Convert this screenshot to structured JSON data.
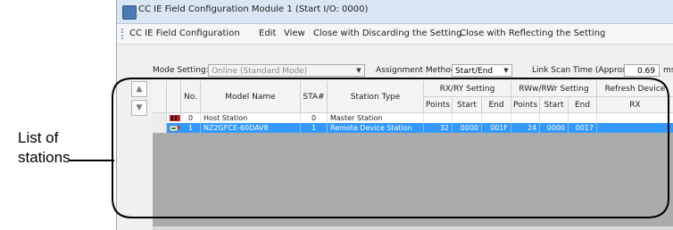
{
  "callout": {
    "label_line1": "List of",
    "label_line2": "stations"
  },
  "window": {
    "title": "CC IE Field Configuration Module 1 (Start I/O: 0000)"
  },
  "menu": {
    "items": [
      "CC IE Field Configuration",
      "Edit",
      "View",
      "Close with Discarding the Setting",
      "Close with Reflecting the Setting"
    ]
  },
  "settings": {
    "mode_label": "Mode Setting:",
    "mode_value": "Online (Standard Mode)",
    "assignment_label": "Assignment Method:",
    "assignment_value": "Start/End",
    "link_scan_label": "Link Scan Time (Approx.):",
    "link_scan_value": "0.69",
    "link_scan_unit": "ms"
  },
  "table": {
    "headers": {
      "no": "No.",
      "model": "Model Name",
      "sta": "STA#",
      "type": "Station Type",
      "rx_group": "RX/RY Setting",
      "rww_group": "RWw/RWr Setting",
      "refresh_group": "Refresh Device",
      "points": "Points",
      "start": "Start",
      "end": "End",
      "rx": "RX"
    },
    "rows": [
      {
        "no": "0",
        "model": "Host Station",
        "sta": "0",
        "type": "Master Station",
        "rx_points": "",
        "rx_start": "",
        "rx_end": "",
        "rw_points": "",
        "rw_start": "",
        "rw_end": "",
        "refresh_rx": ""
      },
      {
        "no": "1",
        "model": "NZ2GFCE-60DAV8",
        "sta": "1",
        "type": "Remote Device Station",
        "rx_points": "32",
        "rx_start": "0000",
        "rx_end": "001F",
        "rw_points": "24",
        "rw_start": "0000",
        "rw_end": "0017",
        "refresh_rx": ""
      }
    ]
  },
  "colors": {
    "selected_row": "#3399ff",
    "empty_area": "#ababab",
    "title_bar": "#dbe6f4"
  },
  "icons": [
    "app-icon",
    "master-station-icon",
    "remote-station-icon",
    "scroll-up-icon",
    "scroll-down-icon",
    "dropdown-arrow-icon"
  ]
}
